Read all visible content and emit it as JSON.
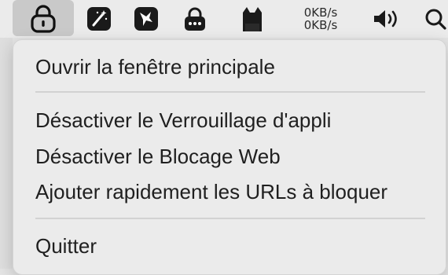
{
  "menubar": {
    "icons": [
      {
        "name": "app-lock-icon",
        "active": true
      },
      {
        "name": "magic-wand-icon"
      },
      {
        "name": "bird-icon"
      },
      {
        "name": "password-lock-icon"
      },
      {
        "name": "cat-icon"
      },
      {
        "name": "network-speed"
      },
      {
        "name": "volume-icon"
      },
      {
        "name": "search-icon"
      }
    ],
    "upload_speed": "0KB/s",
    "download_speed": "0KB/s"
  },
  "menu": {
    "items": [
      {
        "label": "Ouvrir la fenêtre principale"
      },
      {
        "label": "Désactiver le Verrouillage d'appli"
      },
      {
        "label": "Désactiver le Blocage Web"
      },
      {
        "label": "Ajouter rapidement les URLs à bloquer"
      },
      {
        "label": "Quitter"
      }
    ]
  }
}
